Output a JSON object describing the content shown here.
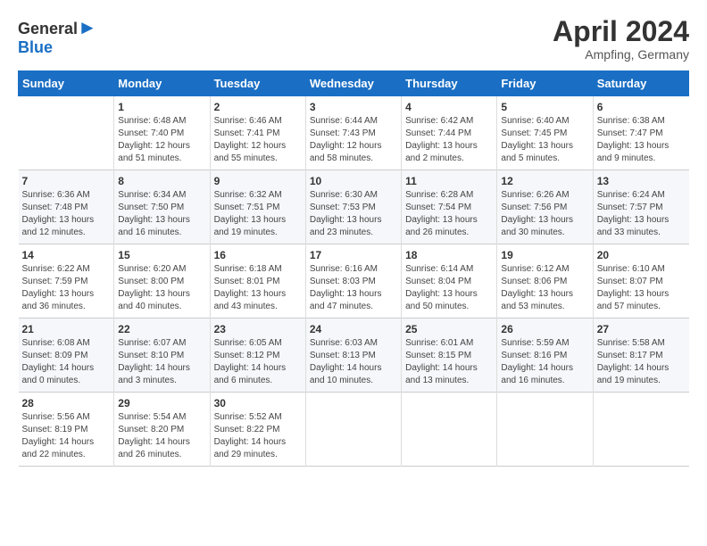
{
  "header": {
    "logo_general": "General",
    "logo_blue": "Blue",
    "month": "April 2024",
    "location": "Ampfing, Germany"
  },
  "weekdays": [
    "Sunday",
    "Monday",
    "Tuesday",
    "Wednesday",
    "Thursday",
    "Friday",
    "Saturday"
  ],
  "weeks": [
    [
      {
        "day": "",
        "sunrise": "",
        "sunset": "",
        "daylight": ""
      },
      {
        "day": "1",
        "sunrise": "Sunrise: 6:48 AM",
        "sunset": "Sunset: 7:40 PM",
        "daylight": "Daylight: 12 hours and 51 minutes."
      },
      {
        "day": "2",
        "sunrise": "Sunrise: 6:46 AM",
        "sunset": "Sunset: 7:41 PM",
        "daylight": "Daylight: 12 hours and 55 minutes."
      },
      {
        "day": "3",
        "sunrise": "Sunrise: 6:44 AM",
        "sunset": "Sunset: 7:43 PM",
        "daylight": "Daylight: 12 hours and 58 minutes."
      },
      {
        "day": "4",
        "sunrise": "Sunrise: 6:42 AM",
        "sunset": "Sunset: 7:44 PM",
        "daylight": "Daylight: 13 hours and 2 minutes."
      },
      {
        "day": "5",
        "sunrise": "Sunrise: 6:40 AM",
        "sunset": "Sunset: 7:45 PM",
        "daylight": "Daylight: 13 hours and 5 minutes."
      },
      {
        "day": "6",
        "sunrise": "Sunrise: 6:38 AM",
        "sunset": "Sunset: 7:47 PM",
        "daylight": "Daylight: 13 hours and 9 minutes."
      }
    ],
    [
      {
        "day": "7",
        "sunrise": "Sunrise: 6:36 AM",
        "sunset": "Sunset: 7:48 PM",
        "daylight": "Daylight: 13 hours and 12 minutes."
      },
      {
        "day": "8",
        "sunrise": "Sunrise: 6:34 AM",
        "sunset": "Sunset: 7:50 PM",
        "daylight": "Daylight: 13 hours and 16 minutes."
      },
      {
        "day": "9",
        "sunrise": "Sunrise: 6:32 AM",
        "sunset": "Sunset: 7:51 PM",
        "daylight": "Daylight: 13 hours and 19 minutes."
      },
      {
        "day": "10",
        "sunrise": "Sunrise: 6:30 AM",
        "sunset": "Sunset: 7:53 PM",
        "daylight": "Daylight: 13 hours and 23 minutes."
      },
      {
        "day": "11",
        "sunrise": "Sunrise: 6:28 AM",
        "sunset": "Sunset: 7:54 PM",
        "daylight": "Daylight: 13 hours and 26 minutes."
      },
      {
        "day": "12",
        "sunrise": "Sunrise: 6:26 AM",
        "sunset": "Sunset: 7:56 PM",
        "daylight": "Daylight: 13 hours and 30 minutes."
      },
      {
        "day": "13",
        "sunrise": "Sunrise: 6:24 AM",
        "sunset": "Sunset: 7:57 PM",
        "daylight": "Daylight: 13 hours and 33 minutes."
      }
    ],
    [
      {
        "day": "14",
        "sunrise": "Sunrise: 6:22 AM",
        "sunset": "Sunset: 7:59 PM",
        "daylight": "Daylight: 13 hours and 36 minutes."
      },
      {
        "day": "15",
        "sunrise": "Sunrise: 6:20 AM",
        "sunset": "Sunset: 8:00 PM",
        "daylight": "Daylight: 13 hours and 40 minutes."
      },
      {
        "day": "16",
        "sunrise": "Sunrise: 6:18 AM",
        "sunset": "Sunset: 8:01 PM",
        "daylight": "Daylight: 13 hours and 43 minutes."
      },
      {
        "day": "17",
        "sunrise": "Sunrise: 6:16 AM",
        "sunset": "Sunset: 8:03 PM",
        "daylight": "Daylight: 13 hours and 47 minutes."
      },
      {
        "day": "18",
        "sunrise": "Sunrise: 6:14 AM",
        "sunset": "Sunset: 8:04 PM",
        "daylight": "Daylight: 13 hours and 50 minutes."
      },
      {
        "day": "19",
        "sunrise": "Sunrise: 6:12 AM",
        "sunset": "Sunset: 8:06 PM",
        "daylight": "Daylight: 13 hours and 53 minutes."
      },
      {
        "day": "20",
        "sunrise": "Sunrise: 6:10 AM",
        "sunset": "Sunset: 8:07 PM",
        "daylight": "Daylight: 13 hours and 57 minutes."
      }
    ],
    [
      {
        "day": "21",
        "sunrise": "Sunrise: 6:08 AM",
        "sunset": "Sunset: 8:09 PM",
        "daylight": "Daylight: 14 hours and 0 minutes."
      },
      {
        "day": "22",
        "sunrise": "Sunrise: 6:07 AM",
        "sunset": "Sunset: 8:10 PM",
        "daylight": "Daylight: 14 hours and 3 minutes."
      },
      {
        "day": "23",
        "sunrise": "Sunrise: 6:05 AM",
        "sunset": "Sunset: 8:12 PM",
        "daylight": "Daylight: 14 hours and 6 minutes."
      },
      {
        "day": "24",
        "sunrise": "Sunrise: 6:03 AM",
        "sunset": "Sunset: 8:13 PM",
        "daylight": "Daylight: 14 hours and 10 minutes."
      },
      {
        "day": "25",
        "sunrise": "Sunrise: 6:01 AM",
        "sunset": "Sunset: 8:15 PM",
        "daylight": "Daylight: 14 hours and 13 minutes."
      },
      {
        "day": "26",
        "sunrise": "Sunrise: 5:59 AM",
        "sunset": "Sunset: 8:16 PM",
        "daylight": "Daylight: 14 hours and 16 minutes."
      },
      {
        "day": "27",
        "sunrise": "Sunrise: 5:58 AM",
        "sunset": "Sunset: 8:17 PM",
        "daylight": "Daylight: 14 hours and 19 minutes."
      }
    ],
    [
      {
        "day": "28",
        "sunrise": "Sunrise: 5:56 AM",
        "sunset": "Sunset: 8:19 PM",
        "daylight": "Daylight: 14 hours and 22 minutes."
      },
      {
        "day": "29",
        "sunrise": "Sunrise: 5:54 AM",
        "sunset": "Sunset: 8:20 PM",
        "daylight": "Daylight: 14 hours and 26 minutes."
      },
      {
        "day": "30",
        "sunrise": "Sunrise: 5:52 AM",
        "sunset": "Sunset: 8:22 PM",
        "daylight": "Daylight: 14 hours and 29 minutes."
      },
      {
        "day": "",
        "sunrise": "",
        "sunset": "",
        "daylight": ""
      },
      {
        "day": "",
        "sunrise": "",
        "sunset": "",
        "daylight": ""
      },
      {
        "day": "",
        "sunrise": "",
        "sunset": "",
        "daylight": ""
      },
      {
        "day": "",
        "sunrise": "",
        "sunset": "",
        "daylight": ""
      }
    ]
  ]
}
